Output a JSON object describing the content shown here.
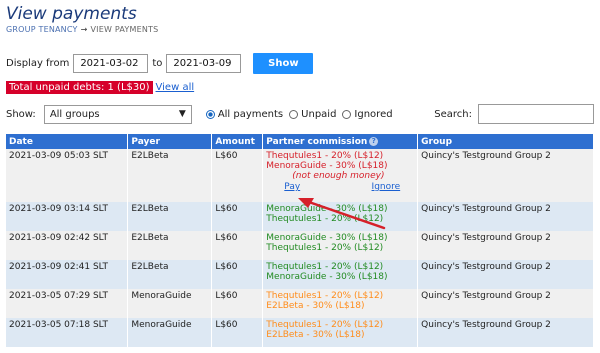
{
  "header": {
    "title": "View payments",
    "breadcrumb": {
      "parent": "GROUP TENANCY",
      "separator": "→",
      "current": "VIEW PAYMENTS"
    }
  },
  "date_filter": {
    "from_label": "Display from",
    "from_value": "2021-03-02",
    "to_label": "to",
    "to_value": "2021-03-09",
    "show_label": "Show"
  },
  "debts": {
    "badge": "Total unpaid debts: 1 (L$30)",
    "view_all": "View all"
  },
  "filters": {
    "show_label": "Show:",
    "group_select": "All groups",
    "radios": [
      "All payments",
      "Unpaid",
      "Ignored"
    ],
    "selected_radio": "All payments",
    "search_label": "Search:",
    "search_value": ""
  },
  "table": {
    "headers": [
      "Date",
      "Payer",
      "Amount",
      "Partner commission",
      "Group"
    ],
    "rows": [
      {
        "date": "2021-03-09 05:03 SLT",
        "payer": "E2LBeta",
        "amount": "L$60",
        "c1": "Thequtules1 - 20% (L$12)",
        "c2": "MenoraGuide - 30% (L$18)",
        "note": "(not enough money)",
        "pay": "Pay",
        "ignore": "Ignore",
        "group": "Quincy's Testground Group 2"
      },
      {
        "date": "2021-03-09 03:14 SLT",
        "payer": "E2LBeta",
        "amount": "L$60",
        "c1": "MenoraGuide - 30% (L$18)",
        "c2": "Thequtules1 - 20% (L$12)",
        "group": "Quincy's Testground Group 2"
      },
      {
        "date": "2021-03-09 02:42 SLT",
        "payer": "E2LBeta",
        "amount": "L$60",
        "c1": "MenoraGuide - 30% (L$18)",
        "c2": "Thequtules1 - 20% (L$12)",
        "group": "Quincy's Testground Group 2"
      },
      {
        "date": "2021-03-09 02:41 SLT",
        "payer": "E2LBeta",
        "amount": "L$60",
        "c1": "Thequtules1 - 20% (L$12)",
        "c2": "MenoraGuide - 30% (L$18)",
        "group": "Quincy's Testground Group 2"
      },
      {
        "date": "2021-03-05 07:29 SLT",
        "payer": "MenoraGuide",
        "amount": "L$60",
        "c1": "Thequtules1 - 20% (L$12)",
        "c2": "E2LBeta - 30% (L$18)",
        "group": "Quincy's Testground Group 2"
      },
      {
        "date": "2021-03-05 07:18 SLT",
        "payer": "MenoraGuide",
        "amount": "L$60",
        "c1": "Thequtules1 - 20% (L$12)",
        "c2": "E2LBeta - 30% (L$18)",
        "group": "Quincy's Testground Group 2"
      }
    ]
  },
  "colors": {
    "header_bg": "#2e6fd0",
    "unpaid": "#d6202a",
    "paid": "#228b22",
    "pending": "#ff8c1a",
    "arrow": "#d6202a"
  },
  "icons": {
    "help": "question-circle-icon",
    "dropdown": "chevron-down-icon",
    "annotation": "red-arrow-icon"
  }
}
